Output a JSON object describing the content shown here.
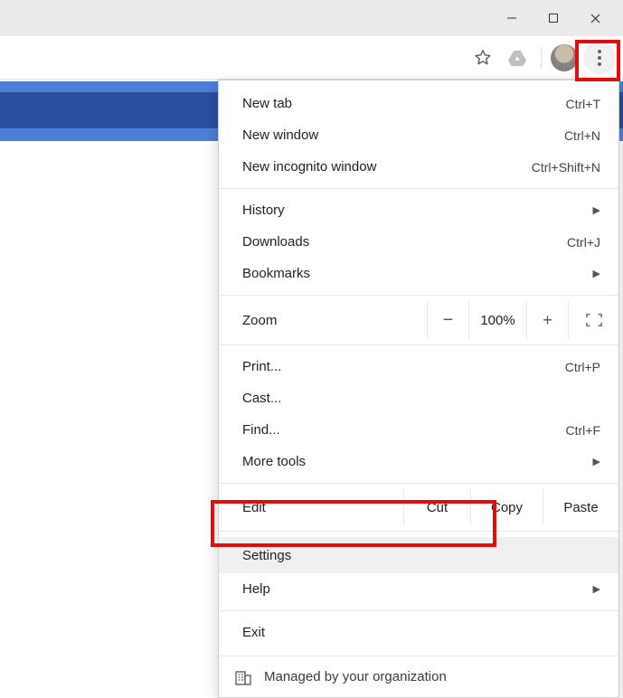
{
  "window": {
    "min": "minimize",
    "max": "maximize",
    "close": "close"
  },
  "toolbar": {
    "bookmark_star": "star-icon",
    "drive": "google-drive-icon",
    "profile": "profile-avatar",
    "kebab": "more-menu"
  },
  "menu": {
    "new_tab": {
      "label": "New tab",
      "shortcut": "Ctrl+T"
    },
    "new_window": {
      "label": "New window",
      "shortcut": "Ctrl+N"
    },
    "new_incognito": {
      "label": "New incognito window",
      "shortcut": "Ctrl+Shift+N"
    },
    "history": {
      "label": "History"
    },
    "downloads": {
      "label": "Downloads",
      "shortcut": "Ctrl+J"
    },
    "bookmarks": {
      "label": "Bookmarks"
    },
    "zoom": {
      "label": "Zoom",
      "value": "100%"
    },
    "print": {
      "label": "Print...",
      "shortcut": "Ctrl+P"
    },
    "cast": {
      "label": "Cast..."
    },
    "find": {
      "label": "Find...",
      "shortcut": "Ctrl+F"
    },
    "more_tools": {
      "label": "More tools"
    },
    "edit": {
      "label": "Edit",
      "cut": "Cut",
      "copy": "Copy",
      "paste": "Paste"
    },
    "settings": {
      "label": "Settings"
    },
    "help": {
      "label": "Help"
    },
    "exit": {
      "label": "Exit"
    },
    "managed": {
      "label": "Managed by your organization"
    }
  },
  "highlights": {
    "kebab": "more-menu-highlight",
    "settings": "settings-highlight"
  }
}
